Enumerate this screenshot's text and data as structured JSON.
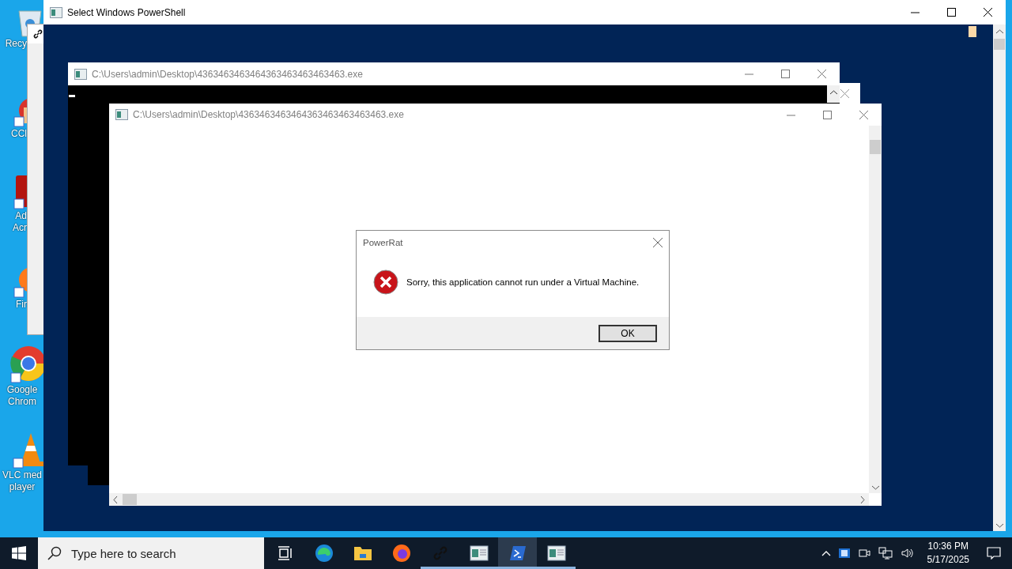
{
  "desktop": {
    "icons": [
      {
        "kind": "recycle-bin",
        "label": "Recy"
      },
      {
        "kind": "cleaner",
        "label": "CCl"
      },
      {
        "kind": "pdf-reader",
        "label": "Ad Acr"
      },
      {
        "kind": "fox-browser",
        "label": "Fir"
      },
      {
        "kind": "round-browser",
        "label": "Google Chrom"
      },
      {
        "kind": "cone-player",
        "label": "VLC med player"
      }
    ]
  },
  "powershell_window": {
    "title": "Select Windows PowerShell"
  },
  "console_windows": [
    {
      "title": "C:\\Users\\admin\\Desktop\\4363463463464363463463463463.exe"
    }
  ],
  "front_window": {
    "title": "C:\\Users\\admin\\Desktop\\4363463463464363463463463463.exe"
  },
  "dialog": {
    "title": "PowerRat",
    "message": "Sorry, this application cannot run under a Virtual Machine.",
    "button": "OK"
  },
  "taskbar": {
    "search": {
      "placeholder": "Type here to search"
    },
    "apps": [
      {
        "kind": "task-view",
        "running": false,
        "selected": false
      },
      {
        "kind": "edge",
        "running": false,
        "selected": false
      },
      {
        "kind": "folder",
        "running": false,
        "selected": false
      },
      {
        "kind": "fox",
        "running": false,
        "selected": false
      },
      {
        "kind": "link",
        "running": true,
        "selected": false
      },
      {
        "kind": "console",
        "running": true,
        "selected": false
      },
      {
        "kind": "powershell",
        "running": true,
        "selected": true
      },
      {
        "kind": "console",
        "running": true,
        "selected": false
      }
    ],
    "time": "10:36 PM",
    "date": "5/17/2025"
  }
}
